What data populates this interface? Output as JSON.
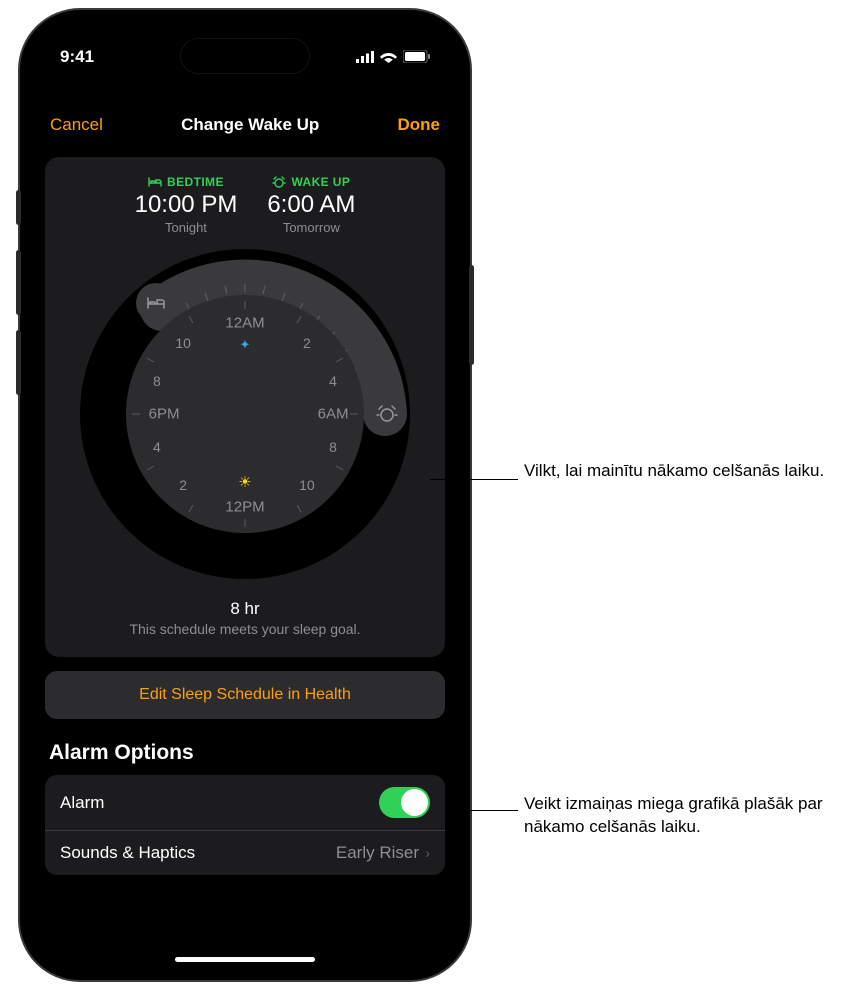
{
  "status": {
    "time": "9:41"
  },
  "nav": {
    "cancel": "Cancel",
    "title": "Change Wake Up",
    "done": "Done"
  },
  "times": {
    "bed": {
      "label": "BEDTIME",
      "value": "10:00 PM",
      "sub": "Tonight"
    },
    "wake": {
      "label": "WAKE UP",
      "value": "6:00 AM",
      "sub": "Tomorrow"
    }
  },
  "dial": {
    "h12am": "12AM",
    "h2t": "2",
    "h4t": "4",
    "h6am": "6AM",
    "h8t": "8",
    "h10t": "10",
    "h12pm": "12PM",
    "h2b": "2",
    "h4b": "4",
    "h6pm": "6PM",
    "h8b": "8",
    "h10b": "10"
  },
  "summary": {
    "hrs": "8 hr",
    "txt": "This schedule meets your sleep goal."
  },
  "editBtn": "Edit Sleep Schedule in Health",
  "optionsHeader": "Alarm Options",
  "rows": {
    "alarm": "Alarm",
    "sounds": "Sounds & Haptics",
    "soundsVal": "Early Riser"
  },
  "callouts": {
    "c1": "Vilkt, lai mainītu nākamo celšanās laiku.",
    "c2": "Veikt izmaiņas miega grafikā plašāk par nākamo celšanās laiku."
  }
}
